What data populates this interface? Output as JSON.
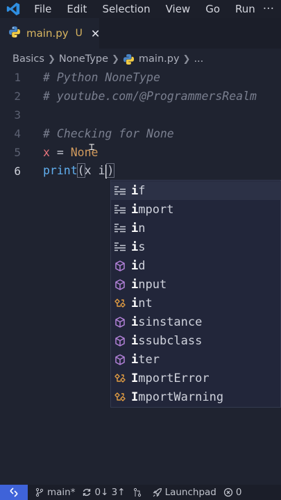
{
  "menubar": {
    "items": [
      "File",
      "Edit",
      "Selection",
      "View",
      "Go",
      "Run"
    ],
    "more": "···"
  },
  "tab": {
    "filename": "main.py",
    "status": "U",
    "close": "✕"
  },
  "breadcrumb": [
    "Basics",
    "NoneType",
    "main.py",
    "..."
  ],
  "editor": {
    "lines": [
      {
        "number": "1",
        "comment": "# Python NoneType"
      },
      {
        "number": "2",
        "comment": "# youtube.com/@ProgrammersRealm"
      },
      {
        "number": "3"
      },
      {
        "number": "4",
        "comment": "# Checking for None"
      },
      {
        "number": "5",
        "var": "x",
        "op": " = ",
        "const": "None"
      },
      {
        "number": "6",
        "fn": "print",
        "open": "(",
        "arg": "x i",
        "close": ")"
      }
    ]
  },
  "suggestions": [
    {
      "match": "i",
      "rest": "f",
      "kind": "keyword"
    },
    {
      "match": "i",
      "rest": "mport",
      "kind": "keyword"
    },
    {
      "match": "i",
      "rest": "n",
      "kind": "keyword"
    },
    {
      "match": "i",
      "rest": "s",
      "kind": "keyword"
    },
    {
      "match": "i",
      "rest": "d",
      "kind": "function"
    },
    {
      "match": "i",
      "rest": "nput",
      "kind": "function"
    },
    {
      "match": "i",
      "rest": "nt",
      "kind": "class"
    },
    {
      "match": "i",
      "rest": "sinstance",
      "kind": "function"
    },
    {
      "match": "i",
      "rest": "ssubclass",
      "kind": "function"
    },
    {
      "match": "i",
      "rest": "ter",
      "kind": "function"
    },
    {
      "match": "I",
      "rest": "mportError",
      "kind": "class"
    },
    {
      "match": "I",
      "rest": "mportWarning",
      "kind": "class"
    }
  ],
  "statusbar": {
    "branch": "main*",
    "sync": "0↓ 3↑",
    "launchpad": "Launchpad",
    "problems": "0"
  },
  "colors": {
    "accent": "#3f63d9",
    "keyword_icon": "#c8ccd6",
    "function_icon": "#b180d7",
    "class_icon": "#e8a043"
  }
}
